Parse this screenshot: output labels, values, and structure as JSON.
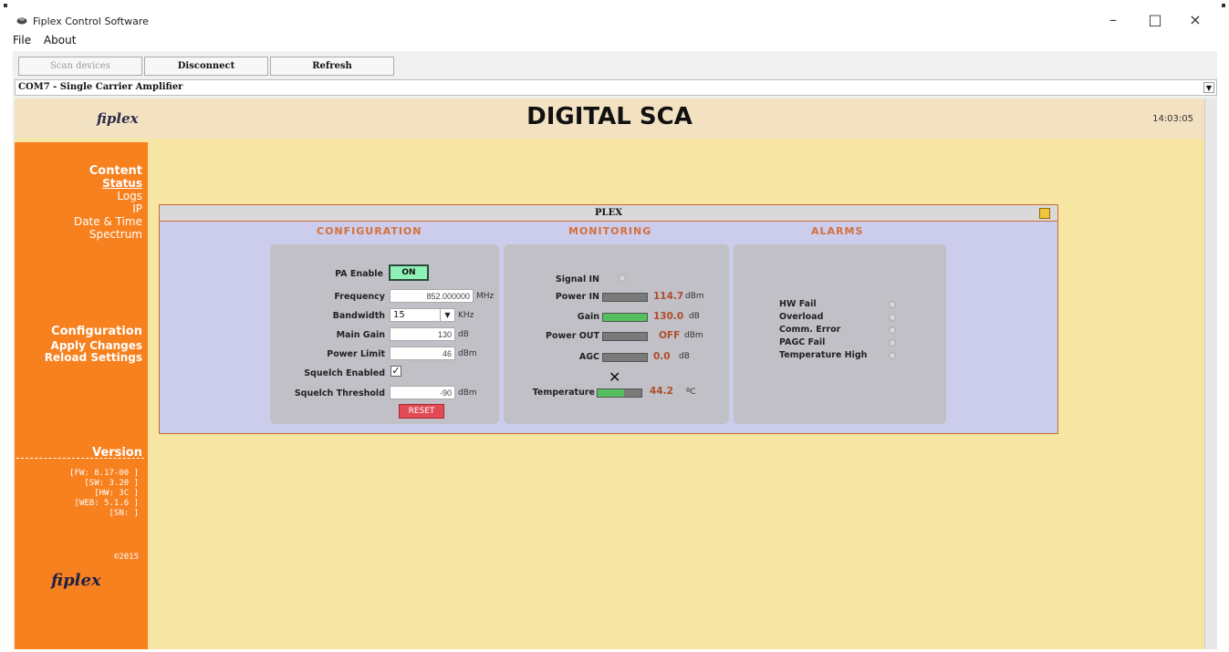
{
  "window": {
    "title": "Fiplex Control Software",
    "minimize_glyph": "–",
    "maximize_glyph": "□",
    "close_glyph": "×"
  },
  "menu": {
    "file": "File",
    "about": "About"
  },
  "toolbar": {
    "scan_label": "Scan devices",
    "disconnect_label": "Disconnect",
    "refresh_label": "Refresh"
  },
  "device_selector": {
    "value": "COM7 - Single Carrier Amplifier"
  },
  "header": {
    "logo": "fiplex",
    "title": "DIGITAL SCA",
    "time": "14:03:05"
  },
  "sidebar": {
    "content_heading": "Content",
    "content_items": [
      {
        "label": "Status",
        "active": true
      },
      {
        "label": "Logs",
        "active": false
      },
      {
        "label": "IP",
        "active": false
      },
      {
        "label": "Date & Time",
        "active": false
      },
      {
        "label": "Spectrum",
        "active": false
      }
    ],
    "config_heading": "Configuration",
    "config_items": [
      "Apply Changes",
      "Reload Settings"
    ],
    "version_heading": "Version",
    "versions": [
      "[FW: 8.17-00 ]",
      "[SW: 3.20 ]",
      "[HW: 3C ]",
      "[WEB: 5.1.6 ]",
      "[SN: ]"
    ],
    "copyright": "©2015",
    "logo": "fiplex"
  },
  "panel": {
    "title": "PLEX",
    "sections": {
      "configuration": "CONFIGURATION",
      "monitoring": "MONITORING",
      "alarms": "ALARMS"
    },
    "configuration": {
      "pa_enable_label": "PA Enable",
      "pa_enable_value": "ON",
      "frequency_label": "Frequency",
      "frequency_value": "852.000000",
      "frequency_unit": "MHz",
      "bandwidth_label": "Bandwidth",
      "bandwidth_value": "15",
      "bandwidth_unit": "KHz",
      "main_gain_label": "Main Gain",
      "main_gain_value": "130",
      "main_gain_unit": "dB",
      "power_limit_label": "Power Limit",
      "power_limit_value": "46",
      "power_limit_unit": "dBm",
      "squelch_enabled_label": "Squelch Enabled",
      "squelch_enabled_checked": true,
      "squelch_threshold_label": "Squelch Threshold",
      "squelch_threshold_value": "-90",
      "squelch_threshold_unit": "dBm",
      "reset_label": "RESET"
    },
    "monitoring": {
      "signal_in_label": "Signal IN",
      "power_in_label": "Power IN",
      "power_in_value": "114.7",
      "power_in_unit": "dBm",
      "gain_label": "Gain",
      "gain_value": "130.0",
      "gain_unit": "dB",
      "power_out_label": "Power OUT",
      "power_out_value": "OFF",
      "power_out_unit": "dBm",
      "agc_label": "AGC",
      "agc_value": "0.0",
      "agc_unit": "dB",
      "x_mark": "✕",
      "temperature_label": "Temperature",
      "temperature_value": "44.2",
      "temperature_unit": "ºC"
    },
    "alarms": {
      "items": [
        "HW Fail",
        "Overload",
        "Comm. Error",
        "PAGC Fail",
        "Temperature High"
      ]
    }
  }
}
